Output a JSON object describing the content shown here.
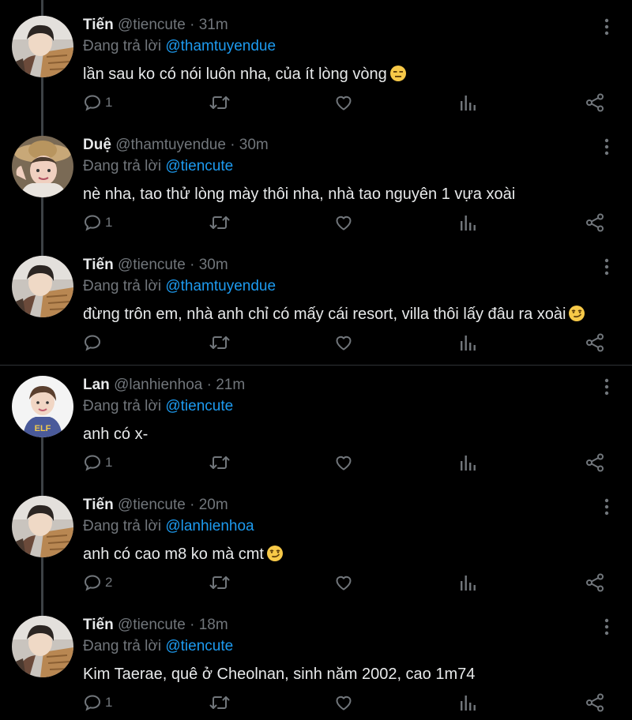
{
  "tweets": [
    {
      "name": "Tiến",
      "handle": "@tiencute",
      "sep": "·",
      "time": "31m",
      "replying_label": "Đang trả lời",
      "replying_to": "@thamtuyendue",
      "text": "lần sau ko có nói luôn nha, của ít lòng vòng",
      "emoji": "expressionless-emoji",
      "reply_count": "1",
      "avatar": "avatar-tien"
    },
    {
      "name": "Duệ",
      "handle": "@thamtuyendue",
      "sep": "·",
      "time": "30m",
      "replying_label": "Đang trả lời",
      "replying_to": "@tiencute",
      "text": "nè nha, tao thử lòng mày thôi nha, nhà tao nguyên 1 vựa xoài",
      "emoji": "",
      "reply_count": "1",
      "avatar": "avatar-due"
    },
    {
      "name": "Tiến",
      "handle": "@tiencute",
      "sep": "·",
      "time": "30m",
      "replying_label": "Đang trả lời",
      "replying_to": "@thamtuyendue",
      "text": "đừng trôn em, nhà anh chỉ có mấy cái resort, villa thôi lấy đâu ra xoài",
      "emoji": "smirking-emoji",
      "reply_count": "",
      "avatar": "avatar-tien"
    },
    {
      "name": "Lan",
      "handle": "@lanhienhoa",
      "sep": "·",
      "time": "21m",
      "replying_label": "Đang trả lời",
      "replying_to": "@tiencute",
      "text": "anh có x-",
      "emoji": "",
      "reply_count": "1",
      "avatar": "avatar-lan"
    },
    {
      "name": "Tiến",
      "handle": "@tiencute",
      "sep": "·",
      "time": "20m",
      "replying_label": "Đang trả lời",
      "replying_to": "@lanhienhoa",
      "text": "anh có cao m8 ko mà cmt",
      "emoji": "smirking-emoji",
      "reply_count": "2",
      "avatar": "avatar-tien"
    },
    {
      "name": "Tiến",
      "handle": "@tiencute",
      "sep": "·",
      "time": "18m",
      "replying_label": "Đang trả lời",
      "replying_to": "@tiencute",
      "text": "Kim Taerae, quê ở Cheolnan, sinh năm 2002, cao 1m74",
      "emoji": "",
      "reply_count": "1",
      "avatar": "avatar-tien"
    }
  ],
  "colors": {
    "background": "#000000",
    "text": "#e7e9ea",
    "muted": "#71767b",
    "mention": "#1d9bf0",
    "thread": "#3d4145"
  }
}
